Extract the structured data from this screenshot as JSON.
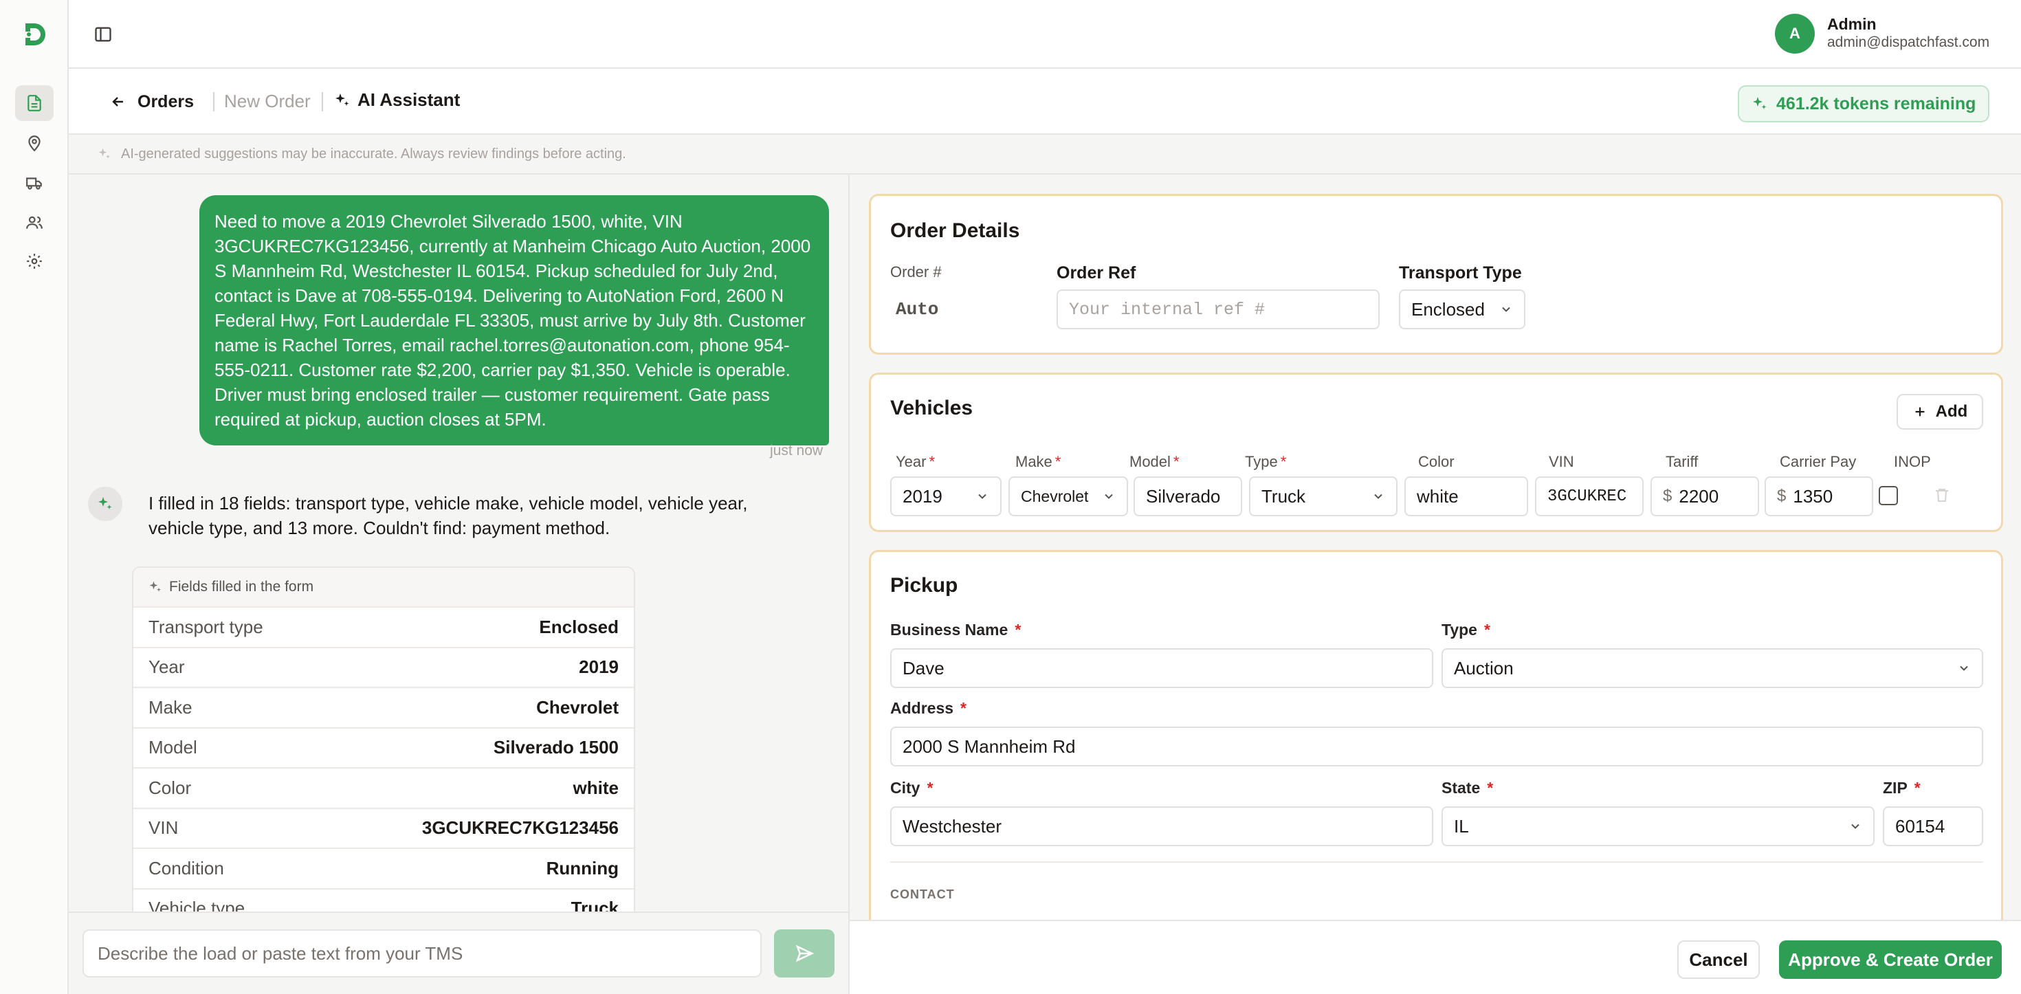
{
  "user": {
    "initial": "A",
    "name": "Admin",
    "email": "admin@dispatchfast.com"
  },
  "breadcrumb": {
    "back": "Orders",
    "new_order": "New Order",
    "current": "AI Assistant"
  },
  "tokens": {
    "label": "461.2k tokens remaining"
  },
  "disclaimer": "AI-generated suggestions may be inaccurate. Always review findings before acting.",
  "chat": {
    "user_message": "Need to move a 2019 Chevrolet Silverado 1500, white, VIN 3GCUKREC7KG123456, currently at Manheim Chicago Auto Auction, 2000 S Mannheim Rd, Westchester IL 60154. Pickup scheduled for July 2nd, contact is Dave at 708-555-0194. Delivering to AutoNation Ford, 2600 N Federal Hwy, Fort Lauderdale FL 33305, must arrive by July 8th. Customer name is Rachel Torres, email rachel.torres@autonation.com, phone 954-555-0211. Customer rate $2,200, carrier pay $1,350. Vehicle is operable. Driver must bring enclosed trailer — customer requirement. Gate pass required at pickup, auction closes at 5PM.",
    "user_time": "just now",
    "ai_message": "I filled in 18 fields: transport type, vehicle make, vehicle model, vehicle year, vehicle type, and 13 more. Couldn't find: payment method.",
    "filled_title": "Fields filled in the form",
    "filled_rows": [
      {
        "key": "Transport type",
        "value": "Enclosed"
      },
      {
        "key": "Year",
        "value": "2019"
      },
      {
        "key": "Make",
        "value": "Chevrolet"
      },
      {
        "key": "Model",
        "value": "Silverado 1500"
      },
      {
        "key": "Color",
        "value": "white"
      },
      {
        "key": "VIN",
        "value": "3GCUKREC7KG123456"
      },
      {
        "key": "Condition",
        "value": "Running"
      },
      {
        "key": "Vehicle type",
        "value": "Truck"
      }
    ],
    "composer_placeholder": "Describe the load or paste text from your TMS"
  },
  "order_details": {
    "title": "Order Details",
    "order_num_label": "Order #",
    "order_num_value": "Auto",
    "order_ref_label": "Order Ref",
    "order_ref_placeholder": "Your internal ref #",
    "transport_type_label": "Transport Type",
    "transport_type_value": "Enclosed"
  },
  "vehicles": {
    "title": "Vehicles",
    "add_label": "Add",
    "headers": {
      "year": "Year",
      "make": "Make",
      "model": "Model",
      "type": "Type",
      "color": "Color",
      "vin": "VIN",
      "tariff": "Tariff",
      "carrier_pay": "Carrier Pay",
      "inop": "INOP"
    },
    "row": {
      "year": "2019",
      "make": "Chevrolet",
      "model": "Silverado",
      "type": "Truck",
      "color": "white",
      "vin": "3GCUKREC",
      "currency": "$",
      "tariff": "2200",
      "carrier_pay": "1350"
    }
  },
  "pickup": {
    "title": "Pickup",
    "business_name_label": "Business Name",
    "business_name_value": "Dave",
    "type_label": "Type",
    "type_value": "Auction",
    "address_label": "Address",
    "address_value": "2000 S Mannheim Rd",
    "city_label": "City",
    "city_value": "Westchester",
    "state_label": "State",
    "state_value": "IL",
    "zip_label": "ZIP",
    "zip_value": "60154",
    "contact_caption": "CONTACT"
  },
  "required_mark": "*",
  "actions": {
    "cancel": "Cancel",
    "approve": "Approve & Create Order"
  },
  "colors": {
    "brand_green": "#2f9e55",
    "card_border": "#f1d9ad",
    "required": "#dc2626"
  }
}
